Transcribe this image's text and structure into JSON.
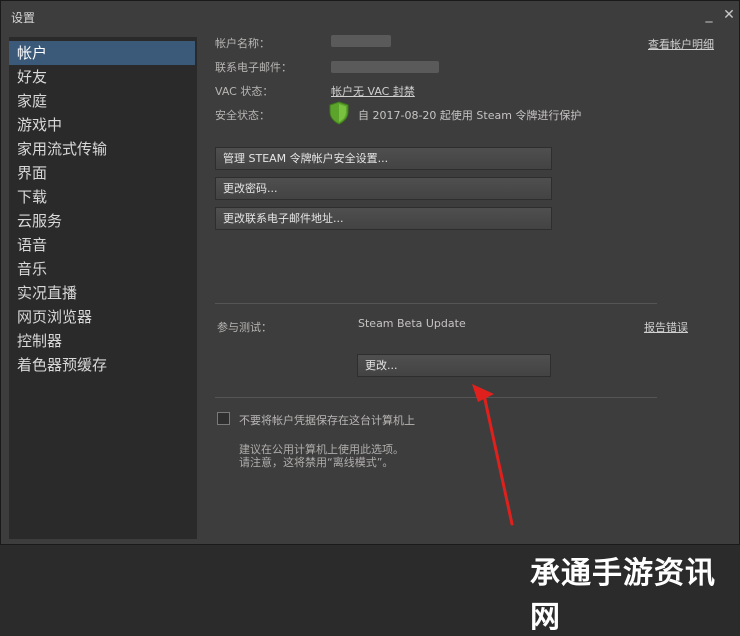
{
  "window": {
    "title": "设置",
    "minimize_glyph": "_",
    "close_glyph": "✕"
  },
  "sidebar": {
    "items": [
      {
        "label": "帐户",
        "active": true
      },
      {
        "label": "好友"
      },
      {
        "label": "家庭"
      },
      {
        "label": "游戏中"
      },
      {
        "label": "家用流式传输"
      },
      {
        "label": "界面"
      },
      {
        "label": "下载"
      },
      {
        "label": "云服务"
      },
      {
        "label": "语音"
      },
      {
        "label": "音乐"
      },
      {
        "label": "实况直播"
      },
      {
        "label": "网页浏览器"
      },
      {
        "label": "控制器"
      },
      {
        "label": "着色器预缓存"
      }
    ]
  },
  "account": {
    "name_label": "帐户名称：",
    "email_label": "联系电子邮件：",
    "vac_label": "VAC 状态：",
    "vac_value": "帐户无 VAC 封禁",
    "security_label": "安全状态：",
    "security_value": "自 2017-08-20 起使用 Steam 令牌进行保护",
    "view_details_link": "查看帐户明细",
    "shield_color": "#5ba32b"
  },
  "actions": {
    "manage_guard": "管理 STEAM 令牌帐户安全设置...",
    "change_password": "更改密码...",
    "change_email": "更改联系电子邮件地址..."
  },
  "beta": {
    "label": "参与测试：",
    "value": "Steam Beta Update",
    "report_link": "报告错误",
    "change_button": "更改..."
  },
  "credentials": {
    "checkbox_label": "不要将帐户凭据保存在这台计算机上",
    "checked": false,
    "note_line1": "建议在公用计算机上使用此选项。",
    "note_line2": "请注意，这将禁用“离线模式”。"
  },
  "annotation": {
    "arrow_color": "#e0201c"
  },
  "watermark": {
    "text": "承通手游资讯网"
  }
}
